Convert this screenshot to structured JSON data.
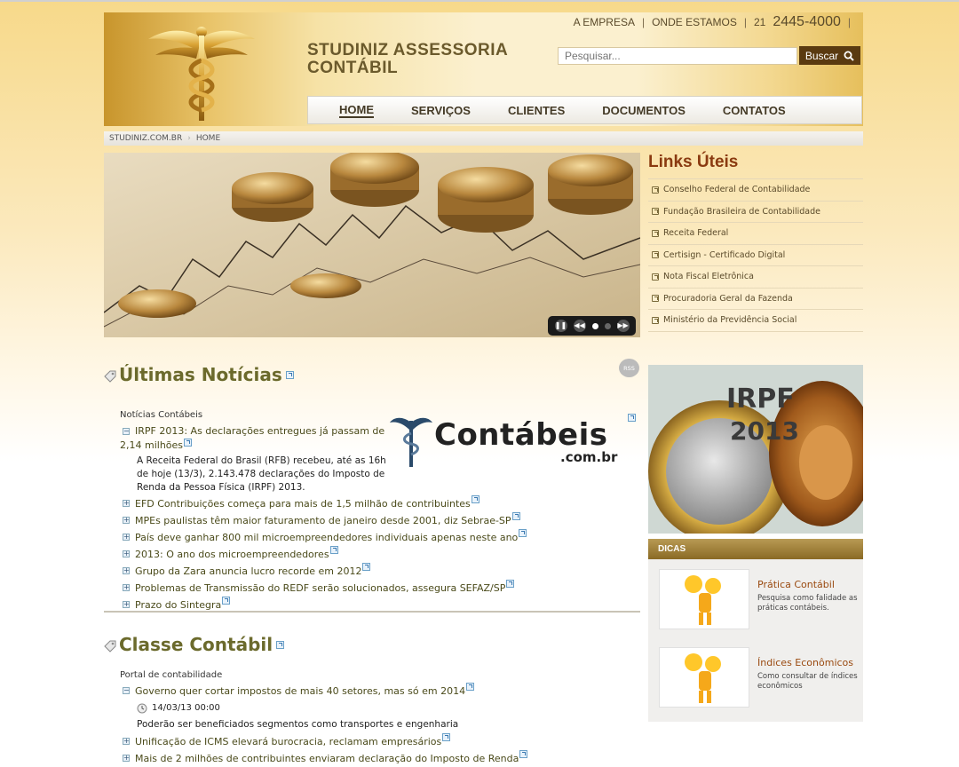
{
  "header": {
    "site_title_line1": "STUDINIZ ASSESSORIA",
    "site_title_line2": "CONTÁBIL",
    "toplinks": [
      "A EMPRESA",
      "ONDE ESTAMOS"
    ],
    "phone_prefix": "21",
    "phone_number": "2445-4000",
    "search_placeholder": "Pesquisar...",
    "search_button": "Buscar"
  },
  "nav": [
    "HOME",
    "SERVIÇOS",
    "CLIENTES",
    "DOCUMENTOS",
    "CONTATOS"
  ],
  "breadcrumb": [
    "STUDINIZ.COM.BR",
    "HOME"
  ],
  "links_uteis": {
    "title": "Links Úteis",
    "items": [
      "Conselho Federal de Contabilidade",
      "Fundação Brasileira de Contabilidade",
      "Receita Federal",
      "Certisign - Certificado Digital",
      "Nota Fiscal Eletrônica",
      "Procuradoria Geral da Fazenda",
      "Ministério da Previdência Social"
    ]
  },
  "ultimas": {
    "title": "Últimas Notícias",
    "rss": "RSS",
    "source": "Notícias Contábeis",
    "featured_title_1": "IRPF 2013: As declarações entregues já passam de",
    "featured_title_2": "2,14 milhões",
    "featured_body": [
      "A Receita Federal do Brasil (RFB) recebeu, até as 16h",
      "de hoje (13/3), 2.143.478 declarações do Imposto de",
      "Renda da Pessoa Física (IRPF) 2013."
    ],
    "logo_text": "Contábeis",
    "logo_sub": ".com.br",
    "items": [
      "EFD Contribuições começa para mais de 1,5 milhão de contribuintes",
      "MPEs paulistas têm maior faturamento de janeiro desde 2001, diz Sebrae-SP",
      "País deve ganhar 800 mil microempreendedores individuais apenas neste ano",
      "2013: O ano dos microempreendedores",
      "Grupo da Zara anuncia lucro recorde em 2012",
      "Problemas de Transmissão do REDF serão solucionados, assegura SEFAZ/SP",
      "Prazo do Sintegra"
    ]
  },
  "classe": {
    "title": "Classe Contábil",
    "source": "Portal de contabilidade",
    "featured_title": "Governo quer cortar impostos de mais 40 setores, mas só em 2014",
    "featured_date": "14/03/13 00:00",
    "featured_body": "Poderão ser beneficiados segmentos como transportes e engenharia",
    "items": [
      "Unificação de ICMS elevará burocracia, reclamam empresários",
      "Mais de 2 milhões de contribuintes enviaram declaração do Imposto de Renda"
    ]
  },
  "promo": {
    "line1": "IRPF",
    "line2": "2013"
  },
  "dicas": {
    "title": "DICAS",
    "items": [
      {
        "title": "Prática Contábil",
        "desc": "Pesquisa como falidade as práticas contábeis."
      },
      {
        "title": "Índices Econômicos",
        "desc": "Como consultar de índices econômicos"
      }
    ]
  }
}
